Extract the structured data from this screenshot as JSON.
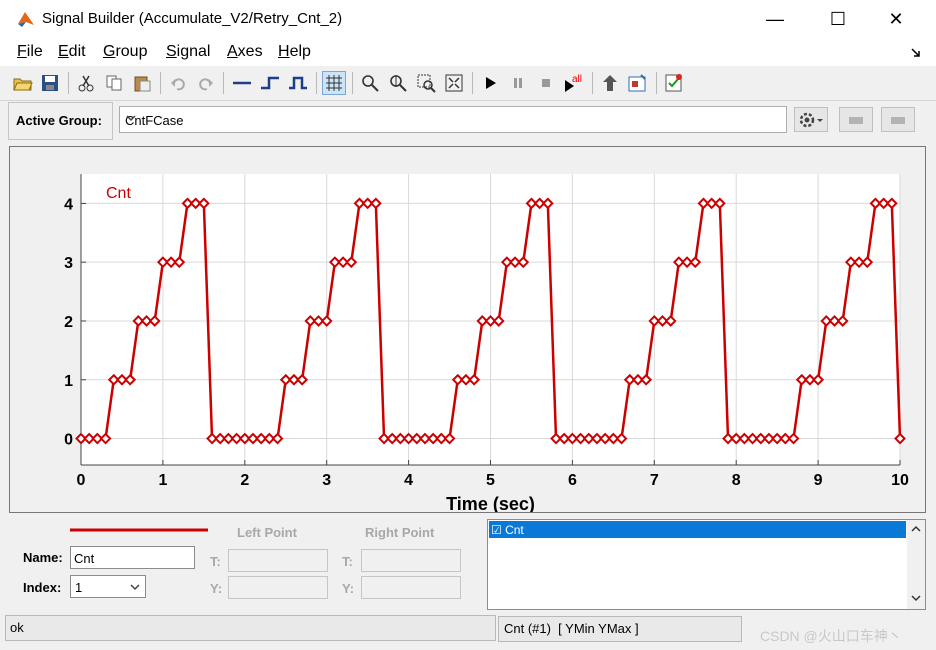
{
  "window": {
    "title": "Signal Builder (Accumulate_V2/Retry_Cnt_2)",
    "minimize_glyph": "—",
    "maximize_glyph": "☐",
    "close_glyph": "✕"
  },
  "menu": [
    {
      "label": "File",
      "key": "F",
      "rest": "ile"
    },
    {
      "label": "Edit",
      "key": "E",
      "rest": "dit"
    },
    {
      "label": "Group",
      "key": "G",
      "rest": "roup"
    },
    {
      "label": "Signal",
      "key": "S",
      "rest": "ignal"
    },
    {
      "label": "Axes",
      "key": "A",
      "rest": "xes"
    },
    {
      "label": "Help",
      "key": "H",
      "rest": "elp"
    }
  ],
  "toolbar_icons": [
    "open-icon",
    "save-icon",
    "cut-icon",
    "copy-icon",
    "paste-icon",
    "undo-icon",
    "redo-icon",
    "add-line-icon",
    "add-step-icon",
    "add-pulse-icon",
    "grid-icon",
    "zoom-x-icon",
    "zoom-y-icon",
    "zoom-xy-icon",
    "fit-icon",
    "run-icon",
    "pause-icon",
    "stop-icon",
    "run-all-icon",
    "upload-icon",
    "model-icon",
    "verify-icon"
  ],
  "group": {
    "label": "Active Group:",
    "value": "CntFCase"
  },
  "chart_data": {
    "type": "line",
    "title": "",
    "xlabel": "Time (sec)",
    "ylabel": "",
    "xlim": [
      0,
      10
    ],
    "ylim": [
      -0.45,
      4.5
    ],
    "xticks": [
      0,
      1,
      2,
      3,
      4,
      5,
      6,
      7,
      8,
      9,
      10
    ],
    "yticks": [
      0,
      1,
      2,
      3,
      4
    ],
    "grid": true,
    "series": [
      {
        "name": "Cnt",
        "color": "#cc0000",
        "marker": "diamond",
        "x": [
          0,
          0.1,
          0.2,
          0.3,
          0.4,
          0.5,
          0.6,
          0.7,
          0.8,
          0.9,
          1.0,
          1.1,
          1.2,
          1.3,
          1.4,
          1.5,
          1.6,
          1.7,
          1.8,
          1.9,
          2.0,
          2.1,
          2.2,
          2.3,
          2.4,
          2.5,
          2.6,
          2.7,
          2.8,
          2.9,
          3.0,
          3.1,
          3.2,
          3.3,
          3.4,
          3.5,
          3.6,
          3.7,
          3.8,
          3.9,
          4.0,
          4.1,
          4.2,
          4.3,
          4.4,
          4.5,
          4.6,
          4.7,
          4.8,
          4.9,
          5.0,
          5.1,
          5.2,
          5.3,
          5.4,
          5.5,
          5.6,
          5.7,
          5.8,
          5.9,
          6.0,
          6.1,
          6.2,
          6.3,
          6.4,
          6.5,
          6.6,
          6.7,
          6.8,
          6.9,
          7.0,
          7.1,
          7.2,
          7.3,
          7.4,
          7.5,
          7.6,
          7.7,
          7.8,
          7.9,
          8.0,
          8.1,
          8.2,
          8.3,
          8.4,
          8.5,
          8.6,
          8.7,
          8.8,
          8.9,
          9.0,
          9.1,
          9.2,
          9.3,
          9.4,
          9.5,
          9.6,
          9.7,
          9.8,
          9.9,
          10.0
        ],
        "y": [
          0,
          0,
          0,
          0,
          1,
          1,
          1,
          2,
          2,
          2,
          3,
          3,
          3,
          4,
          4,
          4,
          0,
          0,
          0,
          0,
          0,
          0,
          0,
          0,
          0,
          1,
          1,
          1,
          2,
          2,
          2,
          3,
          3,
          3,
          4,
          4,
          4,
          0,
          0,
          0,
          0,
          0,
          0,
          0,
          0,
          0,
          1,
          1,
          1,
          2,
          2,
          2,
          3,
          3,
          3,
          4,
          4,
          4,
          0,
          0,
          0,
          0,
          0,
          0,
          0,
          0,
          0,
          1,
          1,
          1,
          2,
          2,
          2,
          3,
          3,
          3,
          4,
          4,
          4,
          0,
          0,
          0,
          0,
          0,
          0,
          0,
          0,
          0,
          1,
          1,
          1,
          2,
          2,
          2,
          3,
          3,
          3,
          4,
          4,
          4,
          0
        ]
      }
    ]
  },
  "signal_panel": {
    "left_point_label": "Left Point",
    "right_point_label": "Right Point",
    "name_label": "Name:",
    "name_value": "Cnt",
    "index_label": "Index:",
    "index_value": "1",
    "t_label": "T:",
    "y_label": "Y:",
    "line_color": "#cc0000"
  },
  "signal_list": {
    "items": [
      {
        "label": "☑ Cnt",
        "selected": true
      }
    ]
  },
  "status": {
    "left": "ok",
    "right": "Cnt (#1)  [ YMin YMax ]",
    "watermark": "CSDN @火山口车神丶"
  }
}
